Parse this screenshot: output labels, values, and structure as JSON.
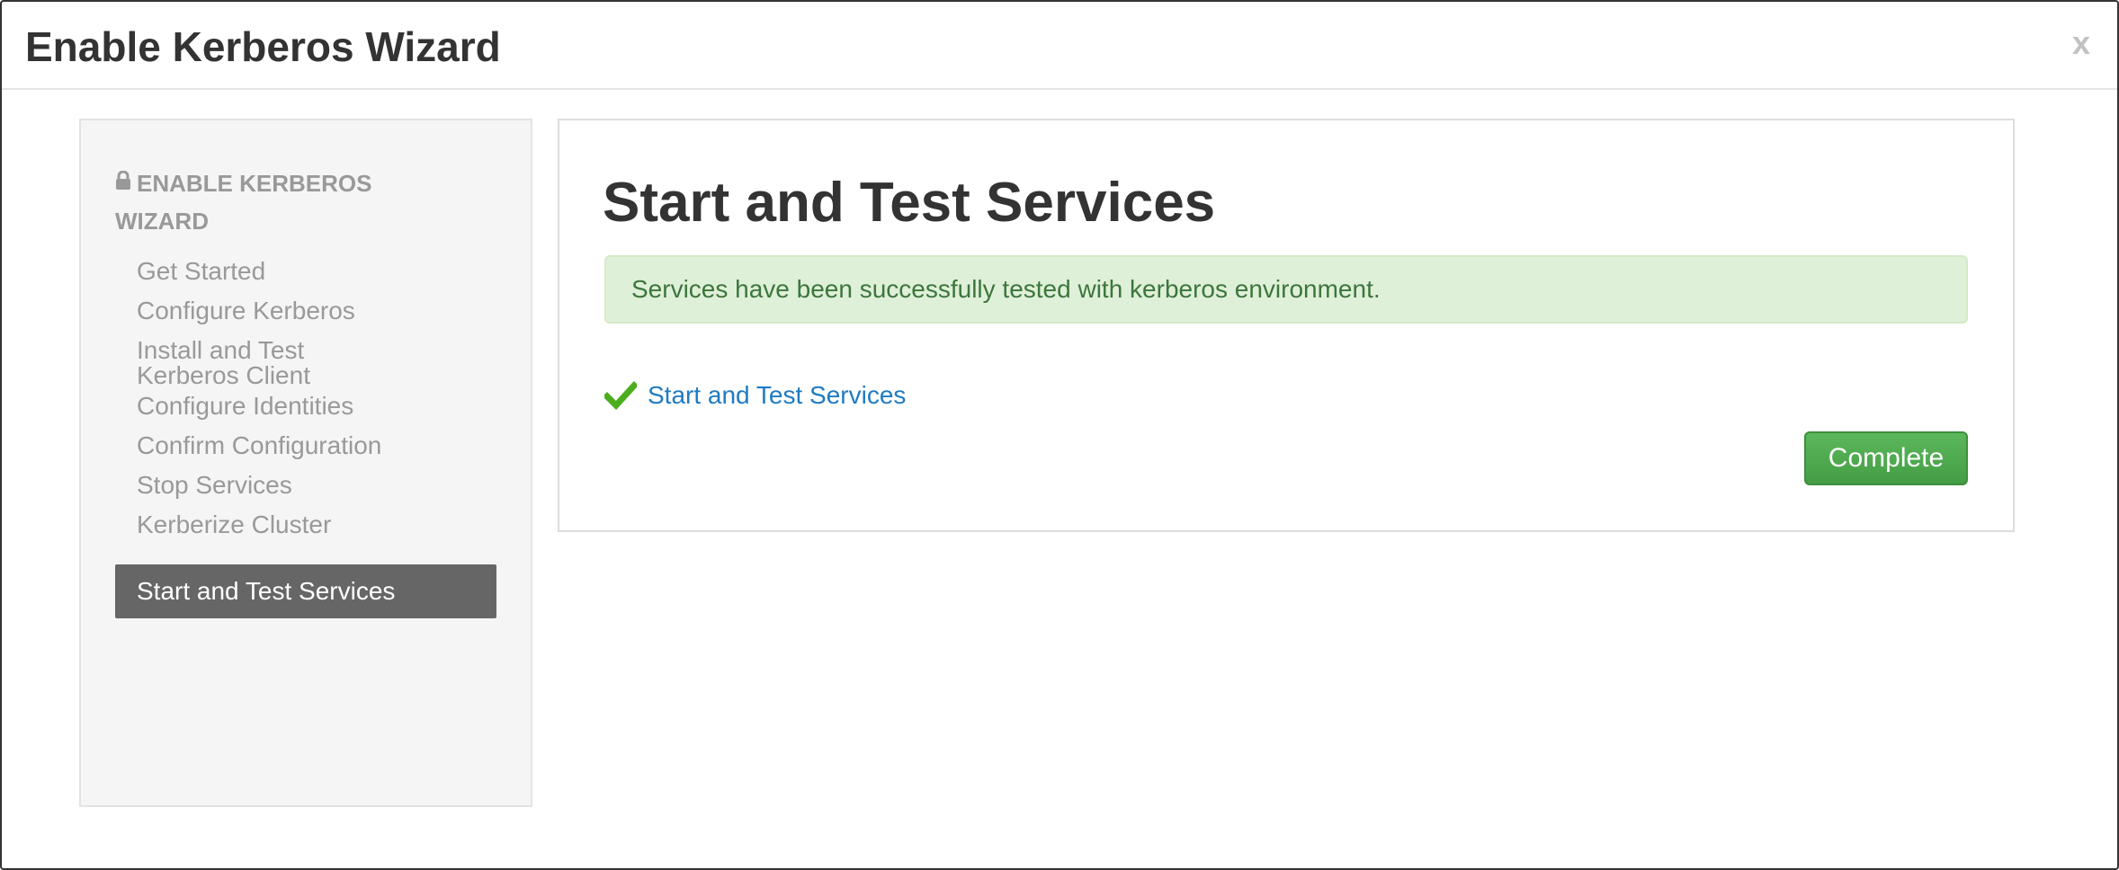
{
  "modal": {
    "title": "Enable Kerberos Wizard",
    "close_label": "x"
  },
  "sidebar": {
    "header": "ENABLE KERBEROS WIZARD",
    "header_icon": "lock-icon",
    "items": [
      {
        "label": "Get Started"
      },
      {
        "label": "Configure Kerberos"
      },
      {
        "label": "Install and Test Kerberos Client"
      },
      {
        "label": "Configure Identities"
      },
      {
        "label": "Confirm Configuration"
      },
      {
        "label": "Stop Services"
      },
      {
        "label": "Kerberize Cluster"
      },
      {
        "label": "Start and Test Services",
        "active": true
      }
    ]
  },
  "main": {
    "title": "Start and Test Services",
    "alert": "Services have been successfully tested with kerberos environment.",
    "task": {
      "icon": "checkmark-icon",
      "label": "Start and Test Services",
      "status_color": "#4cae1f"
    },
    "complete_label": "Complete"
  },
  "colors": {
    "alert_bg": "#dff0d8",
    "alert_text": "#3c763d",
    "link": "#1f7bc1",
    "button_green": "#5cb85c",
    "active_nav_bg": "#666666"
  }
}
